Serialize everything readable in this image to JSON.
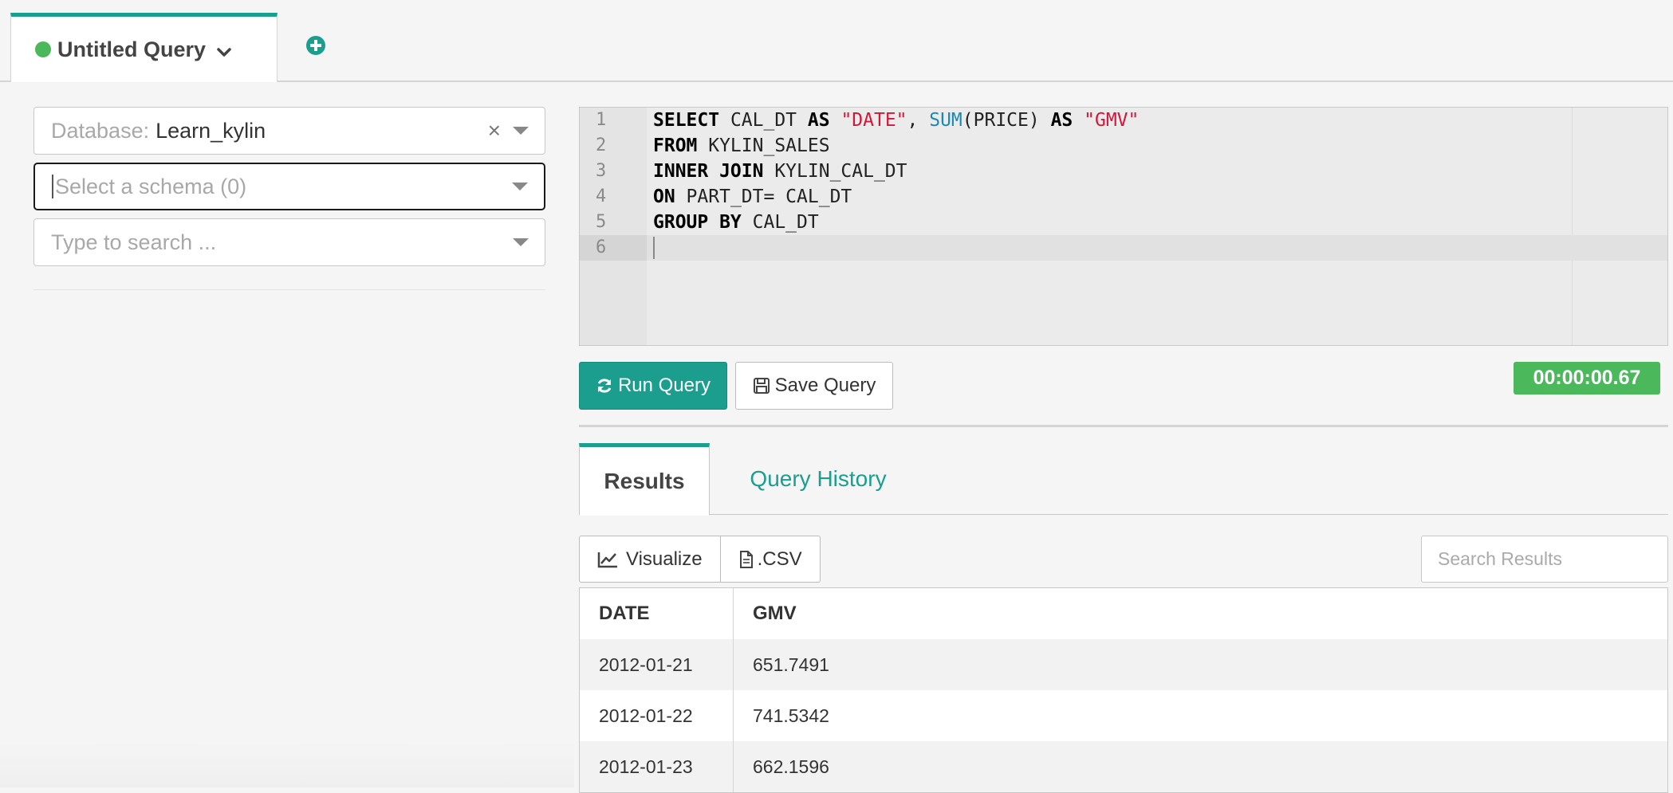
{
  "query_tab": {
    "title": "Untitled Query",
    "status_color": "#4cb85c"
  },
  "left": {
    "database_label": "Database:",
    "database_value": "Learn_kylin",
    "schema_placeholder": "Select a schema (0)",
    "search_placeholder": "Type to search ..."
  },
  "editor": {
    "line_numbers": [
      "1",
      "2",
      "3",
      "4",
      "5",
      "6"
    ],
    "tokens": {
      "l1_select": "SELECT",
      "l1_col": " CAL_DT ",
      "l1_as1": "AS",
      "l1_sp1": " ",
      "l1_alias1": "\"DATE\"",
      "l1_comma": ", ",
      "l1_sum": "SUM",
      "l1_args": "(PRICE) ",
      "l1_as2": "AS",
      "l1_sp2": " ",
      "l1_alias2": "\"GMV\"",
      "l2_from": "FROM",
      "l2_table": " KYLIN_SALES",
      "l3_join": "INNER JOIN",
      "l3_table": " KYLIN_CAL_DT",
      "l4_on": "ON",
      "l4_cond": " PART_DT= CAL_DT",
      "l5_group": "GROUP BY",
      "l5_col": " CAL_DT"
    }
  },
  "toolbar": {
    "run_label": "Run Query",
    "save_label": "Save Query",
    "elapsed": "00:00:00.67"
  },
  "result_tabs": {
    "results": "Results",
    "history": "Query History"
  },
  "results_toolbar": {
    "visualize_label": "Visualize",
    "csv_label": ".CSV",
    "search_placeholder": "Search Results"
  },
  "table": {
    "headers": [
      "DATE",
      "GMV"
    ],
    "rows": [
      [
        "2012-01-21",
        "651.7491"
      ],
      [
        "2012-01-22",
        "741.5342"
      ],
      [
        "2012-01-23",
        "662.1596"
      ]
    ]
  },
  "colors": {
    "accent": "#1b9e8e",
    "success": "#4cb85c",
    "string": "#d1173a",
    "function": "#1a8ab5"
  }
}
